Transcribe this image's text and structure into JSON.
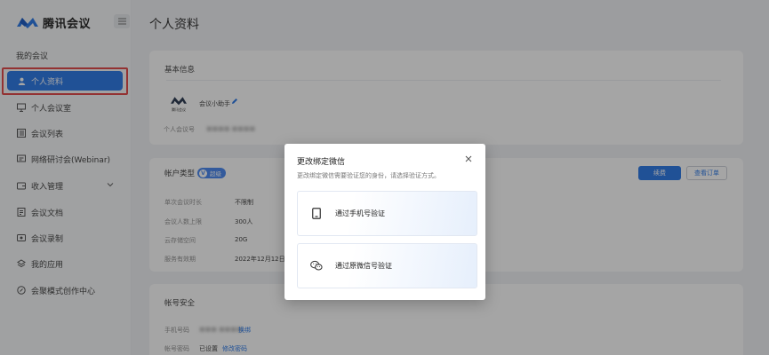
{
  "app": {
    "brand_name": "腾讯会议"
  },
  "sidebar": {
    "collapse_icon": "menu-collapse-icon",
    "section_title": "我的会议",
    "items": [
      {
        "label": "个人资料",
        "icon": "user-icon",
        "active": true
      },
      {
        "label": "个人会议室",
        "icon": "monitor-icon"
      },
      {
        "label": "会议列表",
        "icon": "list-icon"
      },
      {
        "label": "网络研讨会(Webinar)",
        "icon": "webinar-icon"
      },
      {
        "label": "收入管理",
        "icon": "wallet-icon",
        "expandable": true
      },
      {
        "label": "会议文档",
        "icon": "document-icon"
      },
      {
        "label": "会议录制",
        "icon": "record-icon"
      },
      {
        "label": "我的应用",
        "icon": "apps-icon"
      },
      {
        "label": "会聚模式创作中心",
        "icon": "creator-icon"
      }
    ]
  },
  "main": {
    "page_title": "个人资料",
    "basic_info": {
      "title": "基本信息",
      "avatar_caption": "腾讯会议",
      "nickname": "会议小助手",
      "meeting_id_label": "个人会议号",
      "meeting_id_value": "■■■■ ■■■■"
    },
    "account_type": {
      "title": "帐户类型",
      "badge": "超级",
      "buy_button": "续费",
      "orders_button": "查看订单",
      "rows": [
        {
          "label": "单次会议时长",
          "value": "不限制"
        },
        {
          "label": "会议人数上限",
          "value": "300人"
        },
        {
          "label": "云存储空间",
          "value": "20G"
        },
        {
          "label": "服务有效期",
          "value": "2022年12月12日"
        }
      ]
    },
    "security": {
      "title": "帐号安全",
      "phone_label": "手机号码",
      "phone_value": "■■■ ■■■■",
      "phone_action": "换绑",
      "password_label": "帐号密码",
      "password_value": "已设置",
      "password_action": "修改密码"
    }
  },
  "modal": {
    "title": "更改绑定微信",
    "subtitle": "更改绑定微信需要验证您的身份，请选择验证方式。",
    "options": [
      {
        "label": "通过手机号验证",
        "icon": "phone-icon"
      },
      {
        "label": "通过原微信号验证",
        "icon": "wechat-icon"
      }
    ]
  },
  "colors": {
    "accent": "#1b6ee6",
    "highlight_frame": "#e03a3a"
  }
}
